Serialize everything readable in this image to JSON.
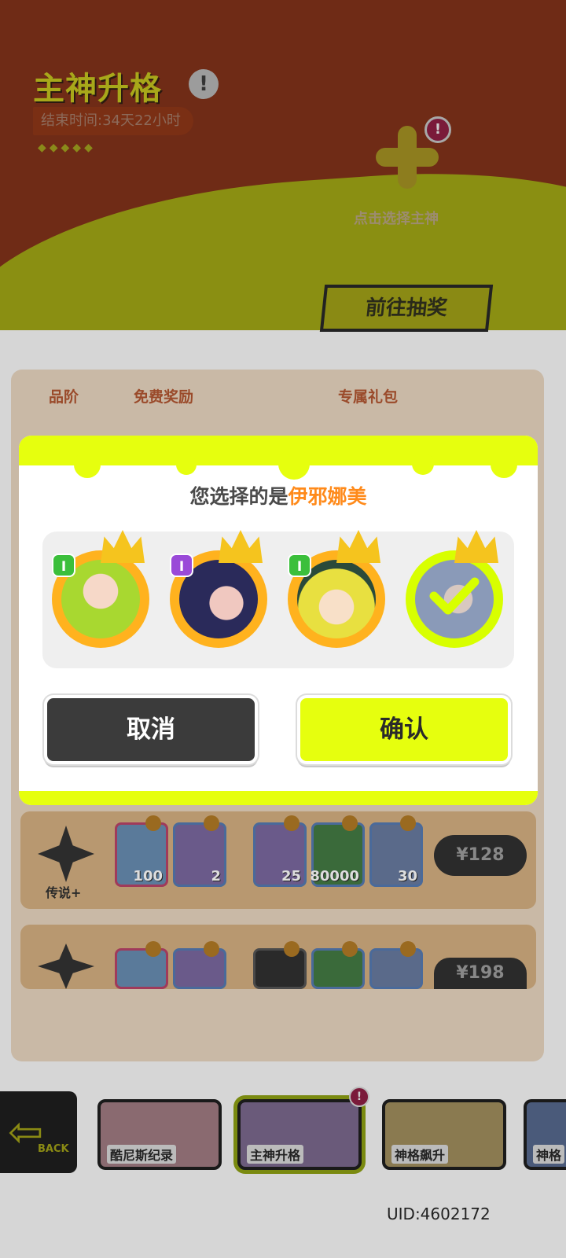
{
  "header": {
    "title": "主神升格",
    "end_time": "结束时间:34天22小时",
    "dots": "◆◆◆◆◆",
    "select_label": "点击选择主神",
    "plus_badge": "!",
    "info_icon": "!"
  },
  "draw_button": "前往抽奖",
  "table": {
    "headers": [
      "品阶",
      "免费奖励",
      "专属礼包"
    ],
    "rows": [
      {
        "tier": "传说+",
        "free_items": [
          {
            "icon": "diamond-icon",
            "count": "100"
          },
          {
            "icon": "ticket-icon",
            "count": "2"
          }
        ],
        "pack_items": [
          {
            "icon": "ticket-icon",
            "count": "25"
          },
          {
            "icon": "cash-icon",
            "count": "80000"
          },
          {
            "icon": "card-icon",
            "count": "30"
          }
        ],
        "price": "¥128"
      },
      {
        "tier": "",
        "free_items": [
          {
            "icon": "diamond-icon",
            "count": ""
          },
          {
            "icon": "ticket-icon",
            "count": ""
          }
        ],
        "pack_items": [
          {
            "icon": "mystery-icon",
            "count": ""
          },
          {
            "icon": "cash-icon",
            "count": ""
          },
          {
            "icon": "card-icon",
            "count": ""
          }
        ],
        "price": "¥198"
      }
    ]
  },
  "modal": {
    "title_prefix": "您选择的是",
    "title_highlight": "伊邪娜美",
    "characters": [
      {
        "name": "green-hair-character",
        "level": "I",
        "level_color": "#3bbf3b",
        "selected": false
      },
      {
        "name": "dark-hair-character",
        "level": "I",
        "level_color": "#9a4ad8",
        "selected": false
      },
      {
        "name": "blonde-cap-character",
        "level": "I",
        "level_color": "#3bbf3b",
        "selected": false
      },
      {
        "name": "grey-hair-character",
        "level": "",
        "level_color": "",
        "selected": true
      }
    ],
    "cancel_label": "取消",
    "confirm_label": "确认"
  },
  "bottom_nav": {
    "back_label": "BACK",
    "tabs": [
      "酷尼斯纪录",
      "主神升格",
      "神格飙升",
      "神格"
    ],
    "active_tab": "主神升格",
    "badge": "!"
  },
  "uid": "UID:4602172",
  "colors": {
    "accent_lime": "#e6ff0e",
    "highlight_orange": "#ff8a1a",
    "cancel_dark": "#3b3b3b",
    "portrait_orange": "#ffb21e"
  }
}
